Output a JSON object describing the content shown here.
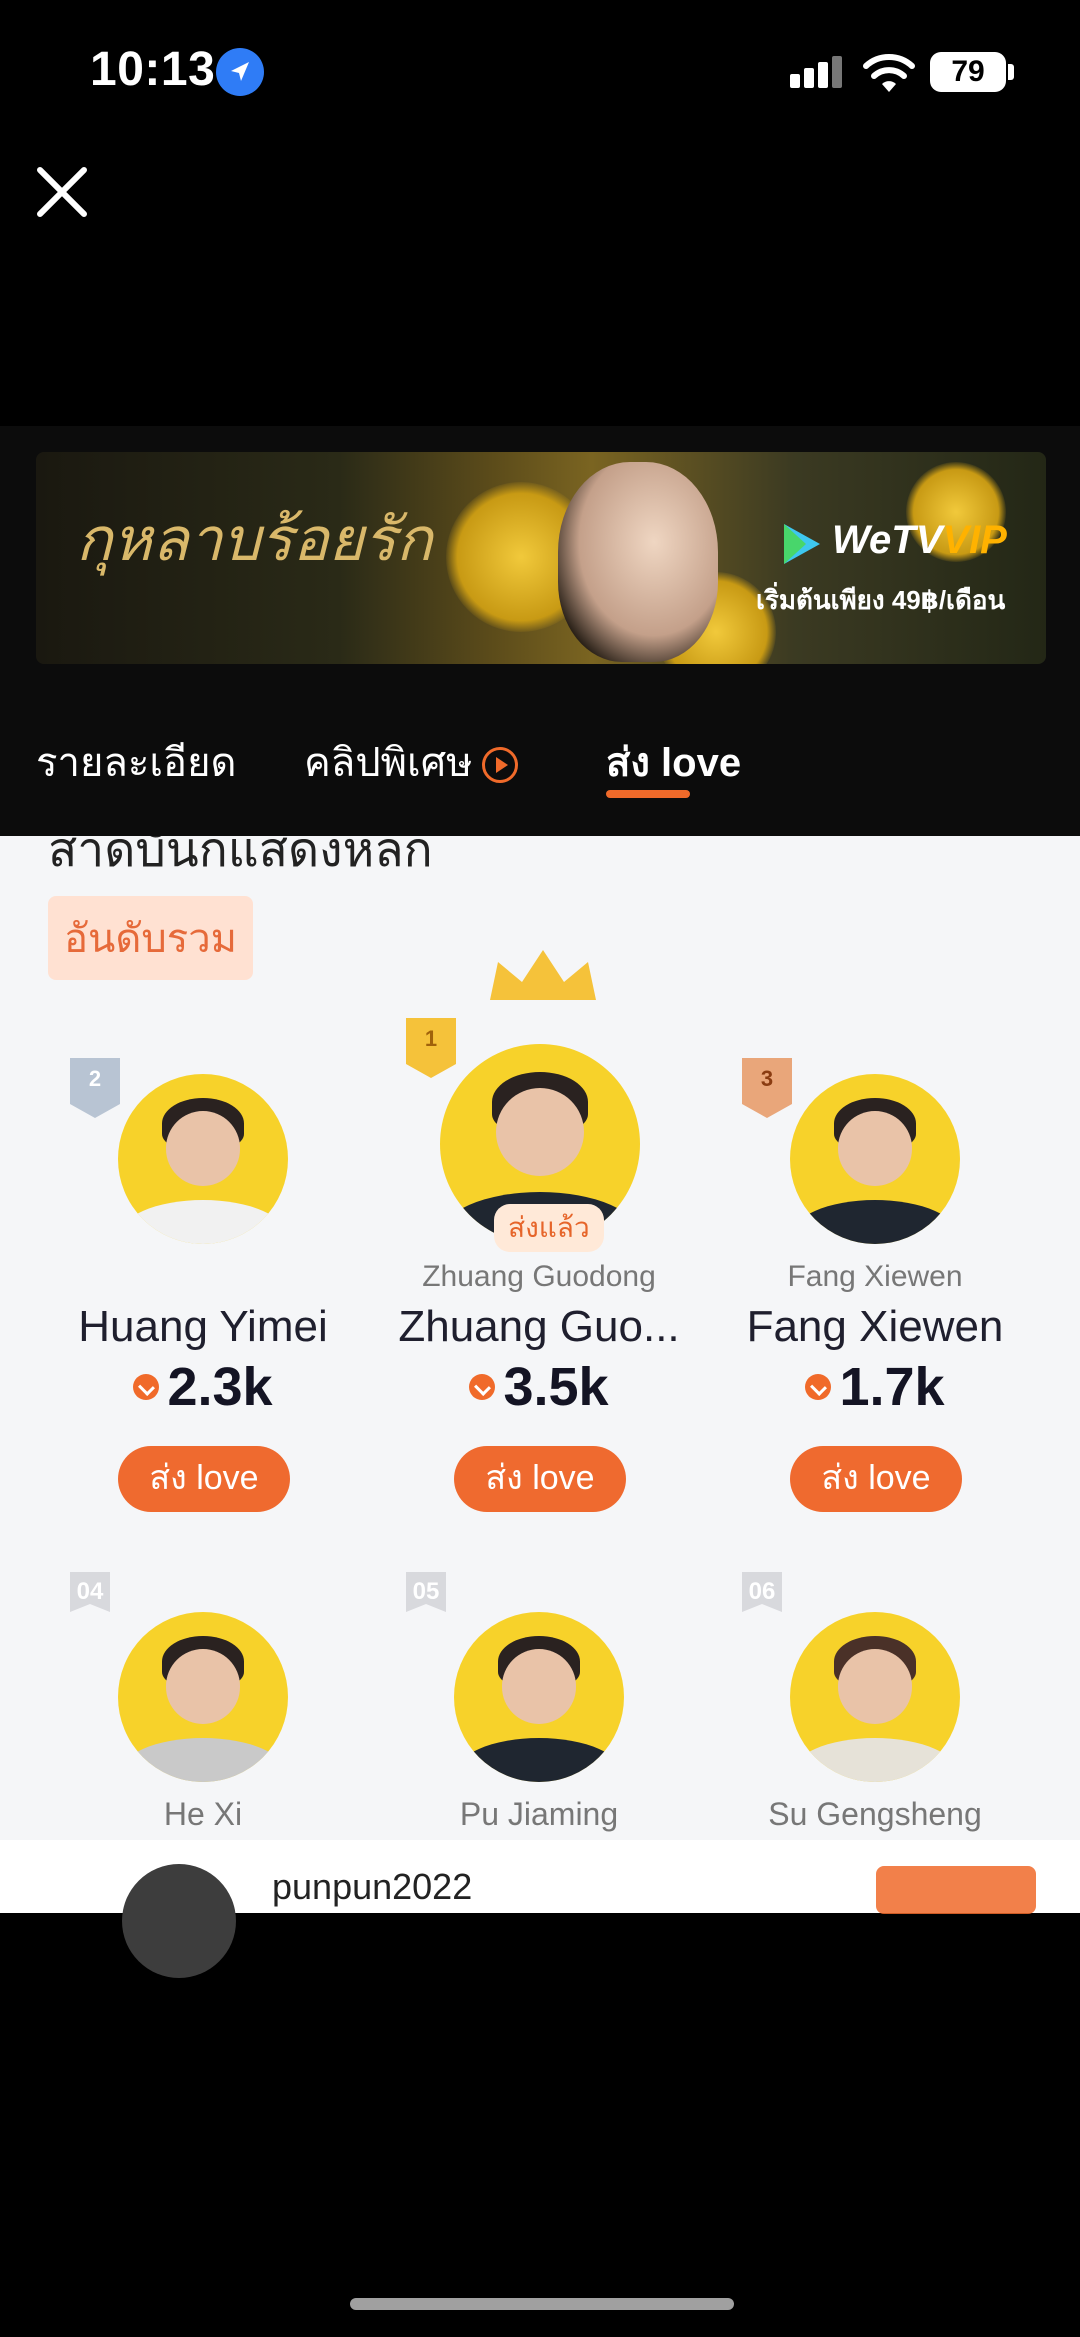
{
  "status": {
    "time": "10:13",
    "battery": "79"
  },
  "banner": {
    "title": "กุหลาบร้อยรัก",
    "brand": "WeTV",
    "vip": "VIP",
    "price_text": "เริ่มต้นเพียง 49฿/เดือน"
  },
  "tabs": [
    {
      "label": "รายละเอียด"
    },
    {
      "label": "คลิปพิเศษ"
    },
    {
      "label": "ส่ง love"
    }
  ],
  "section": {
    "cut_heading": "สาดบันกแสดงหลก",
    "rank_label": "อันดับรวม"
  },
  "top3": [
    {
      "rank": "2",
      "subname": "",
      "name": "Huang Yimei",
      "score": "2.3k",
      "button": "ส่ง love"
    },
    {
      "rank": "1",
      "subname": "Zhuang Guodong",
      "name": "Zhuang Guo...",
      "score": "3.5k",
      "button": "ส่ง love",
      "badge": "ส่งแล้ว"
    },
    {
      "rank": "3",
      "subname": "Fang Xiewen",
      "name": "Fang Xiewen",
      "score": "1.7k",
      "button": "ส่ง love"
    }
  ],
  "row2": [
    {
      "rank": "04",
      "name": "He Xi"
    },
    {
      "rank": "05",
      "name": "Pu Jiaming"
    },
    {
      "rank": "06",
      "name": "Su Gengsheng"
    }
  ],
  "overlay": {
    "username": "punpun2022"
  },
  "colors": {
    "accent": "#ef6a2f",
    "avatar_bg": "#f7d22a",
    "gold": "#f5c23a",
    "silver": "#b8c4d3",
    "bronze": "#e9a67a"
  }
}
